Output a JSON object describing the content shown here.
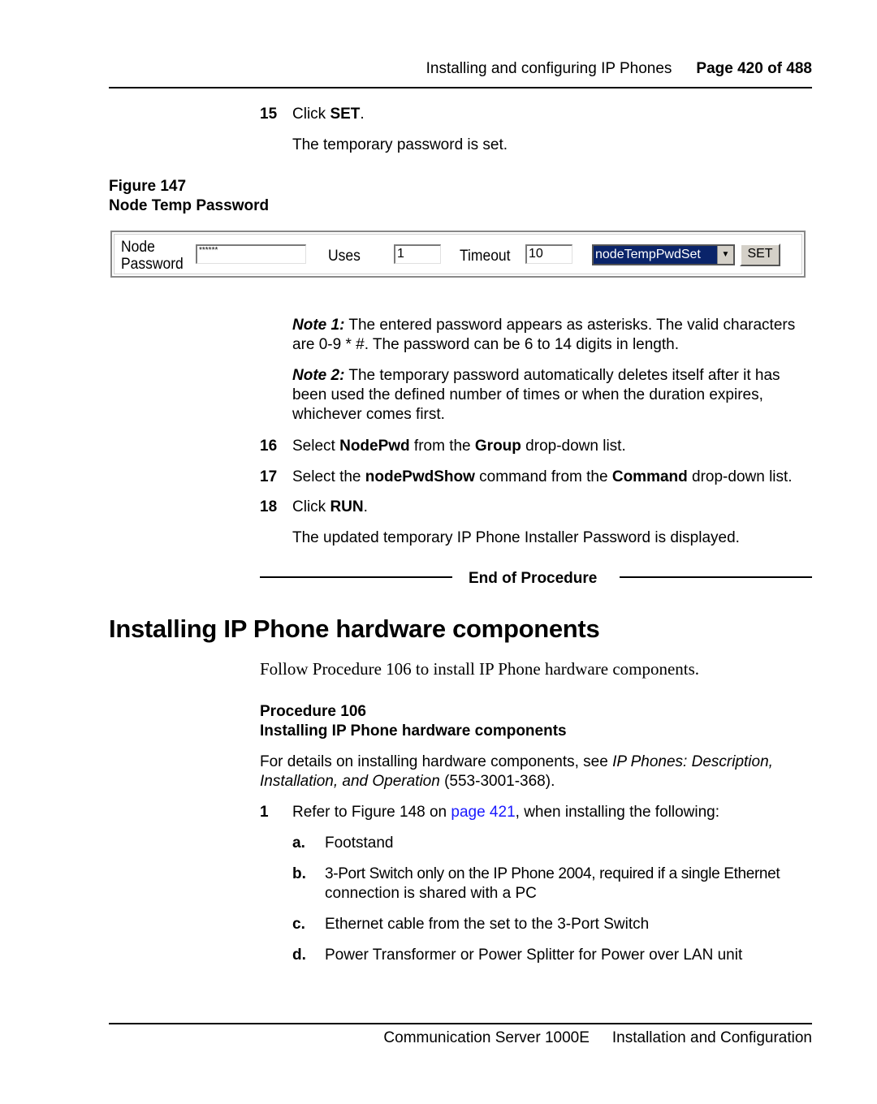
{
  "header": {
    "section": "Installing and configuring IP Phones",
    "page_label": "Page 420 of 488"
  },
  "step15": {
    "number": "15",
    "prefix": "Click ",
    "bold": "SET",
    "suffix": ".",
    "result": "The temporary password is set."
  },
  "figure": {
    "number_label": "Figure 147",
    "title": "Node Temp Password",
    "widget": {
      "node_label_line1": "Node",
      "node_label_line2": "Password",
      "password_value": "******",
      "uses_label": "Uses",
      "uses_value": "1",
      "timeout_label": "Timeout",
      "timeout_value": "10",
      "command_selected": "nodeTempPwdSet",
      "dropdown_arrow": "▼",
      "set_button": "SET"
    }
  },
  "notes": [
    {
      "label": "Note 1:",
      "text": " The entered password appears as asterisks. The valid characters are 0-9 * #. The password can be 6 to 14 digits in length."
    },
    {
      "label": "Note 2:",
      "text": " The temporary password automatically deletes itself after it has been used the defined number of times or when the duration expires, whichever comes first."
    }
  ],
  "step16": {
    "number": "16",
    "t1": "Select ",
    "b1": "NodePwd",
    "t2": " from the ",
    "b2": "Group",
    "t3": " drop-down list."
  },
  "step17": {
    "number": "17",
    "t1": "Select the ",
    "b1": "nodePwdShow",
    "t2": " command from the ",
    "b2": "Command",
    "t3": " drop-down list."
  },
  "step18": {
    "number": "18",
    "t1": "Click ",
    "b1": "RUN",
    "t2": ".",
    "result": "The updated temporary IP Phone Installer Password is displayed."
  },
  "end_of_procedure": "End of Procedure",
  "section": {
    "heading": "Installing IP Phone hardware components",
    "intro": "Follow Procedure 106 to install IP Phone hardware components."
  },
  "procedure": {
    "number_label": "Procedure 106",
    "title": "Installing IP Phone hardware components",
    "details_t1": "For details on installing hardware components, see ",
    "details_i1": "IP Phones: Description,",
    "details_i2": "Installation, and Operation",
    "details_t2": " (553-3001-368).",
    "step1": {
      "number": "1",
      "t1": "Refer to Figure 148 on ",
      "link": "page 421",
      "t2": ", when installing the following:"
    },
    "items": [
      {
        "letter": "a.",
        "text": "Footstand"
      },
      {
        "letter": "b.",
        "line1": "3-Port Switch only on the IP Phone 2004, required if a single Ethernet",
        "line2": "connection is shared with a PC"
      },
      {
        "letter": "c.",
        "text": "Ethernet cable from the set to the 3-Port Switch"
      },
      {
        "letter": "d.",
        "text": "Power Transformer or Power Splitter for Power over LAN unit"
      }
    ]
  },
  "footer": {
    "product": "Communication Server 1000E",
    "doc": "Installation and Configuration"
  },
  "colors": {
    "link": "#1a1aff",
    "select_highlight": "#0a246a",
    "button_face": "#d4d0c8"
  }
}
